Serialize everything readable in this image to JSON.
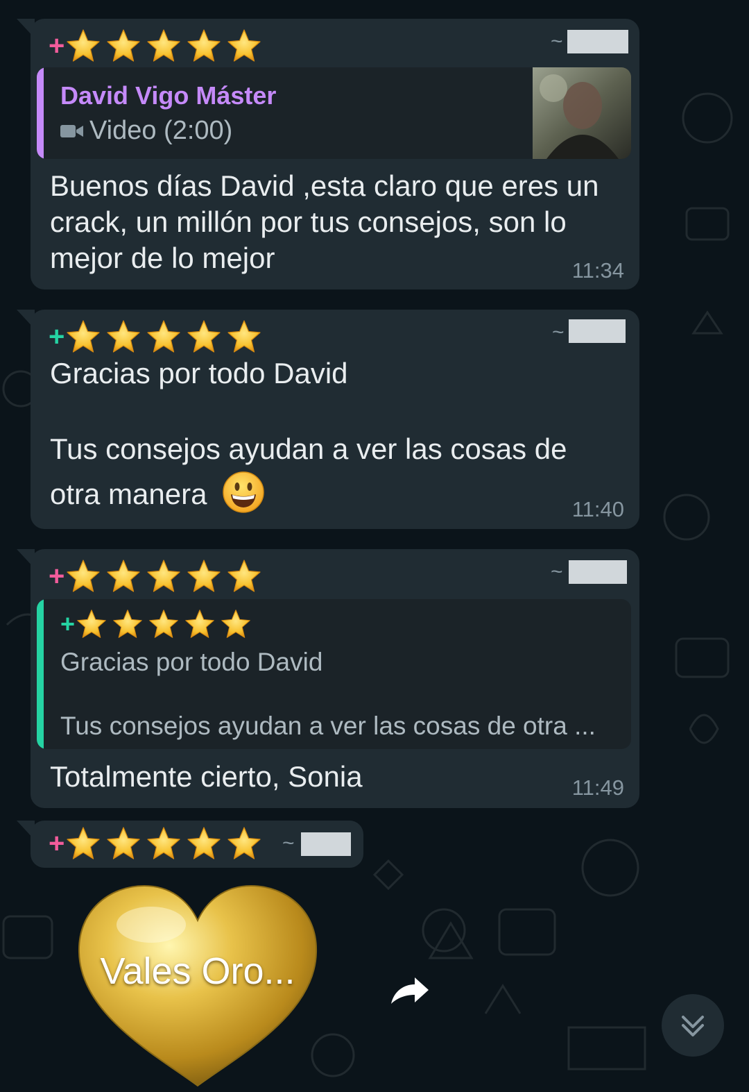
{
  "colors": {
    "background": "#0b141a",
    "bubble": "#202c33",
    "quote_bg": "#1b2328",
    "pink": "#f15c9b",
    "teal": "#53bdeb",
    "green": "#25d3a3",
    "purple": "#c58af9",
    "meta": "#8696a0",
    "text": "#e9edef",
    "redaction": "#d1d7db",
    "gold": "#f3c23f"
  },
  "messages": [
    {
      "sender_prefix": "+",
      "sender_stars": "★★★★★",
      "tilde": "~",
      "quote": {
        "author": "David Vigo Máster",
        "media_icon": "video-camera-icon",
        "media_label": "Video (2:00)"
      },
      "text": "Buenos días David ,esta claro que eres un crack, un millón por tus consejos, son lo mejor de lo mejor",
      "time": "11:34"
    },
    {
      "sender_prefix": "+",
      "sender_stars": "★★★★★",
      "tilde": "~",
      "text_line1": "Gracias por todo David",
      "text_line2": "Tus consejos ayudan a ver las cosas de otra manera",
      "emoji": "grinning-face-emoji",
      "time": "11:40"
    },
    {
      "sender_prefix": "+",
      "sender_stars": "★★★★★",
      "tilde": "~",
      "quote": {
        "prefix": "+",
        "stars": "★★★★★",
        "line1": "Gracias por todo David",
        "line2": "Tus consejos ayudan a ver las cosas de otra ..."
      },
      "text": "Totalmente cierto, Sonia",
      "time": "11:49"
    },
    {
      "sender_prefix": "+",
      "sender_stars": "★★★★★",
      "tilde": "~",
      "sticker_text": "Vales Oro..."
    }
  ],
  "actions": {
    "forward_icon": "forward-arrow-icon",
    "scroll_down_icon": "double-chevron-down-icon"
  }
}
